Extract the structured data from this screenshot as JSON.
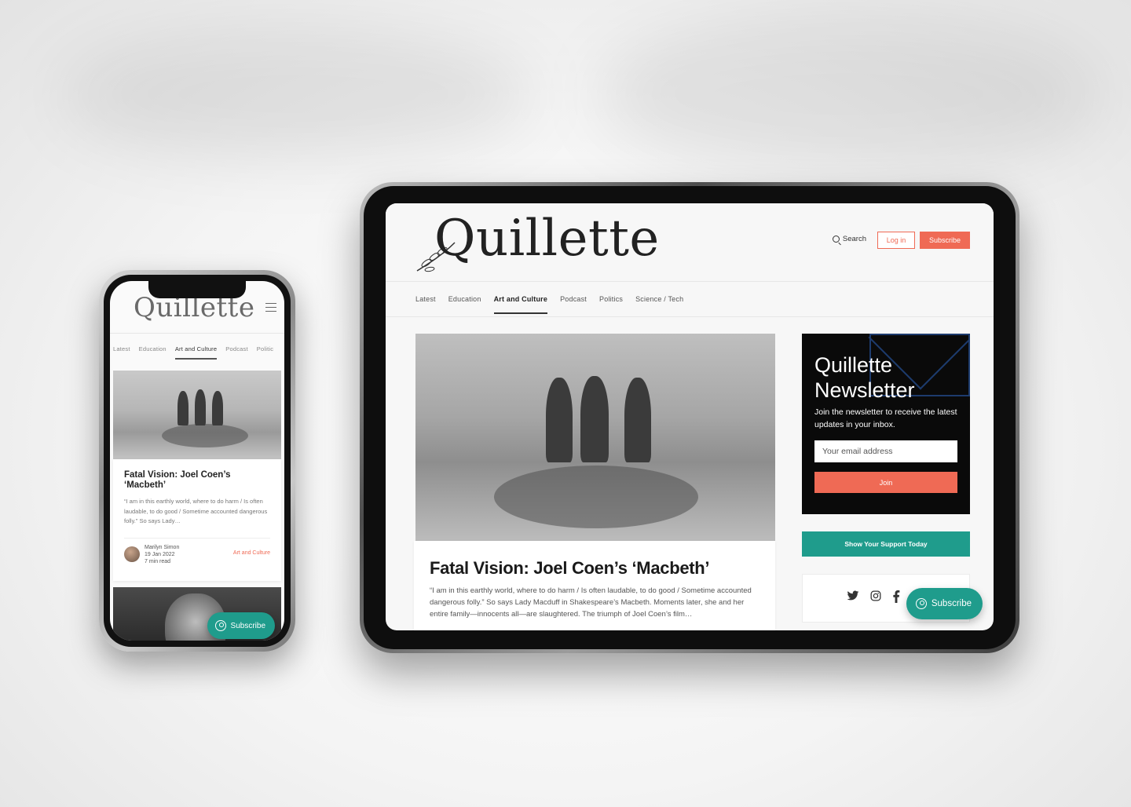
{
  "brand": {
    "name": "Quillette",
    "accent": "#ef6a55",
    "teal": "#1f9c8c"
  },
  "phone": {
    "nav": [
      "Latest",
      "Education",
      "Art and Culture",
      "Podcast",
      "Politic"
    ],
    "article": {
      "title": "Fatal Vision: Joel Coen’s ‘Macbeth’",
      "excerpt": "“I am in this earthly world, where to do harm / Is often laudable, to do good / Sometime accounted dangerous folly.” So says Lady…",
      "author": "Marilyn Simon",
      "date": "19 Jan 2022",
      "read_time": "7 min read",
      "category": "Art and Culture"
    },
    "subscribe_label": "Subscribe"
  },
  "tablet": {
    "header": {
      "search_label": "Search",
      "login_label": "Log in",
      "subscribe_label": "Subscribe"
    },
    "nav": [
      "Latest",
      "Education",
      "Art and Culture",
      "Podcast",
      "Politics",
      "Science / Tech"
    ],
    "article": {
      "title": "Fatal Vision: Joel Coen’s ‘Macbeth’",
      "excerpt": "“I am in this earthly world, where to do harm / Is often laudable, to do good / Sometime accounted dangerous folly.” So says Lady Macduff in Shakespeare’s Macbeth. Moments later, she and her entire family—innocents all—are slaughtered. The triumph of Joel Coen’s film…"
    },
    "newsletter": {
      "title": "Quillette Newsletter",
      "text": "Join the newsletter to receive the latest updates in your inbox.",
      "email_placeholder": "Your email address",
      "join_label": "Join"
    },
    "support_label": "Show Your Support Today",
    "social_icons": [
      "twitter-icon",
      "instagram-icon",
      "facebook-icon"
    ],
    "float_subscribe_label": "Subscribe"
  }
}
